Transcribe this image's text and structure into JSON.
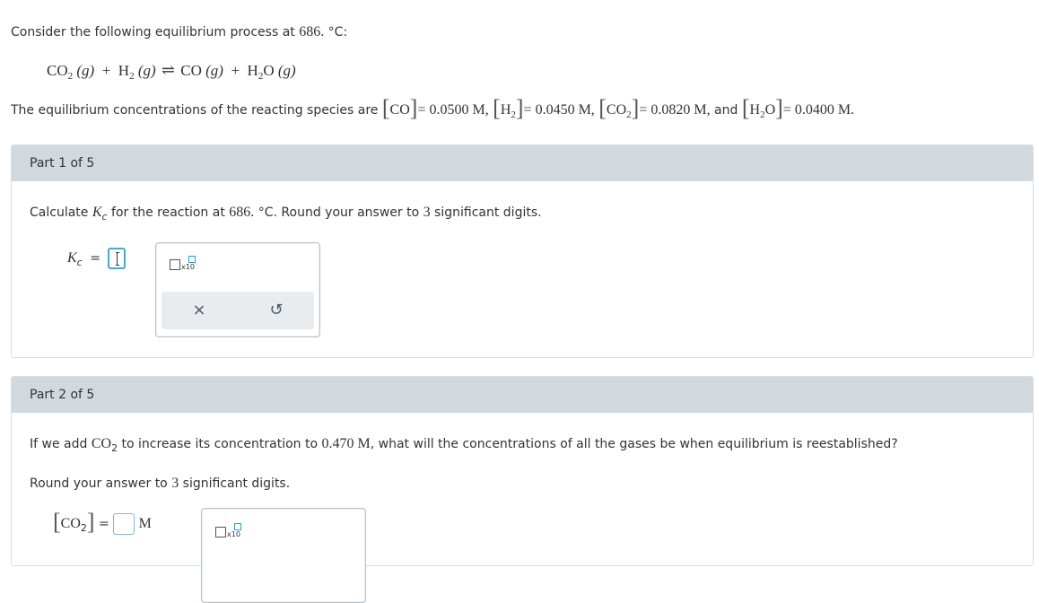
{
  "intro": {
    "prefix": "Consider the following equilibrium process at ",
    "temp": "686.",
    "unit": " °C:"
  },
  "equation": {
    "co2": "CO",
    "co2_sub": "2",
    "g1": "(g)",
    "plus1": "+",
    "h2": "H",
    "h2_sub": "2",
    "g2": "(g)",
    "arrow": "⇌",
    "co": "CO",
    "g3": "(g)",
    "plus2": "+",
    "h2o_h": "H",
    "h2o_sub": "2",
    "h2o_o": "O",
    "g4": "(g)"
  },
  "concentrations": {
    "prefix": "The equilibrium concentrations of the reacting species are ",
    "co_label": "CO",
    "co_value": "= 0.0500 M,",
    "h2_label": "H",
    "h2_sub": "2",
    "h2_value": "= 0.0450 M,",
    "co2_label": "CO",
    "co2_sub": "2",
    "co2_value": "= 0.0820 M,",
    "and": " and ",
    "h2o_label": "H",
    "h2o_sub": "2",
    "h2o_o": "O",
    "h2o_value": "= 0.0400 M."
  },
  "part1": {
    "header": "Part 1 of 5",
    "q_prefix": "Calculate ",
    "k": "K",
    "k_sub": "c",
    "q_mid": " for the reaction at ",
    "temp": "686.",
    "q_mid2": " °C. Round your answer to ",
    "digits": "3",
    "q_suffix": " significant digits.",
    "answer_label_k": "K",
    "answer_label_sub": "c",
    "answer_eq": "=",
    "x10_label": "x10",
    "clear_icon": "×",
    "undo_icon": "↺"
  },
  "part2": {
    "header": "Part 2 of 5",
    "q_prefix": "If we add ",
    "co2": "CO",
    "co2_sub": "2",
    "q_mid": " to increase its concentration to ",
    "value": "0.470 M",
    "q_suffix": ", what will the concentrations of all the gases be when equilibrium is reestablished?",
    "round_prefix": "Round your answer to ",
    "digits": "3",
    "round_suffix": " significant digits.",
    "answer_label": "CO",
    "answer_sub": "2",
    "answer_eq": "=",
    "unit": "M",
    "x10_label": "x10"
  }
}
